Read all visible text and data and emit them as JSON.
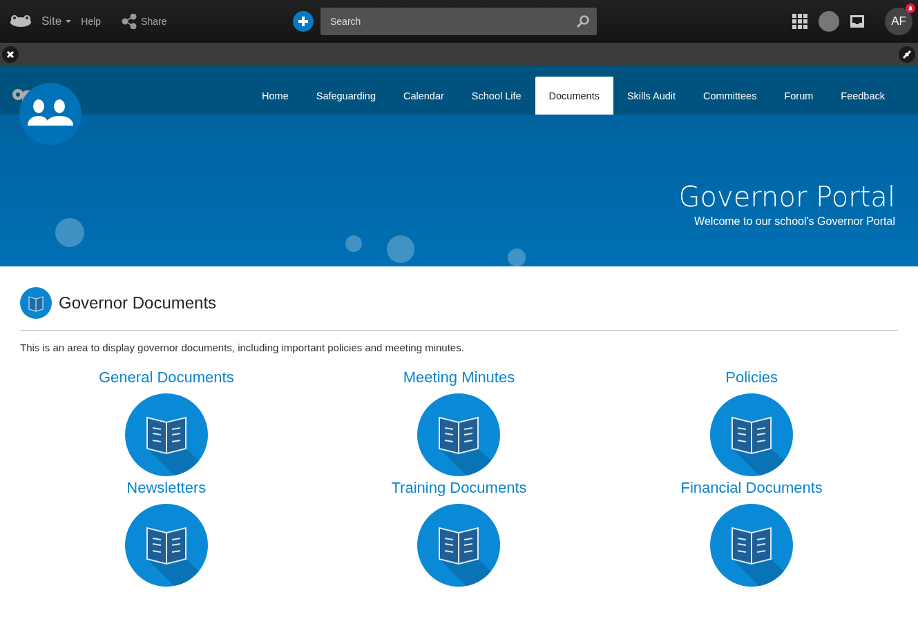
{
  "topbar": {
    "site_label": "Site",
    "help": "Help",
    "share": "Share",
    "search": {
      "placeholder": "Search"
    },
    "user_initials": "AF"
  },
  "nav": [
    {
      "label": "Home",
      "selected": false
    },
    {
      "label": "Safeguarding",
      "selected": false
    },
    {
      "label": "Calendar",
      "selected": false
    },
    {
      "label": "School Life",
      "selected": false
    },
    {
      "label": "Documents",
      "selected": true
    },
    {
      "label": "Skills Audit",
      "selected": false
    },
    {
      "label": "Committees",
      "selected": false
    },
    {
      "label": "Forum",
      "selected": false
    },
    {
      "label": "Feedback",
      "selected": false
    }
  ],
  "banner": {
    "title": "Governor Portal",
    "subtitle": "Welcome to our school's Governor Portal"
  },
  "section": {
    "title": "Governor Documents",
    "description": "This is an area to display governor documents, including important policies and meeting minutes."
  },
  "tiles": [
    {
      "label": "General Documents"
    },
    {
      "label": "Meeting Minutes"
    },
    {
      "label": "Policies"
    },
    {
      "label": "Newsletters"
    },
    {
      "label": "Training Documents"
    },
    {
      "label": "Financial Documents"
    }
  ]
}
